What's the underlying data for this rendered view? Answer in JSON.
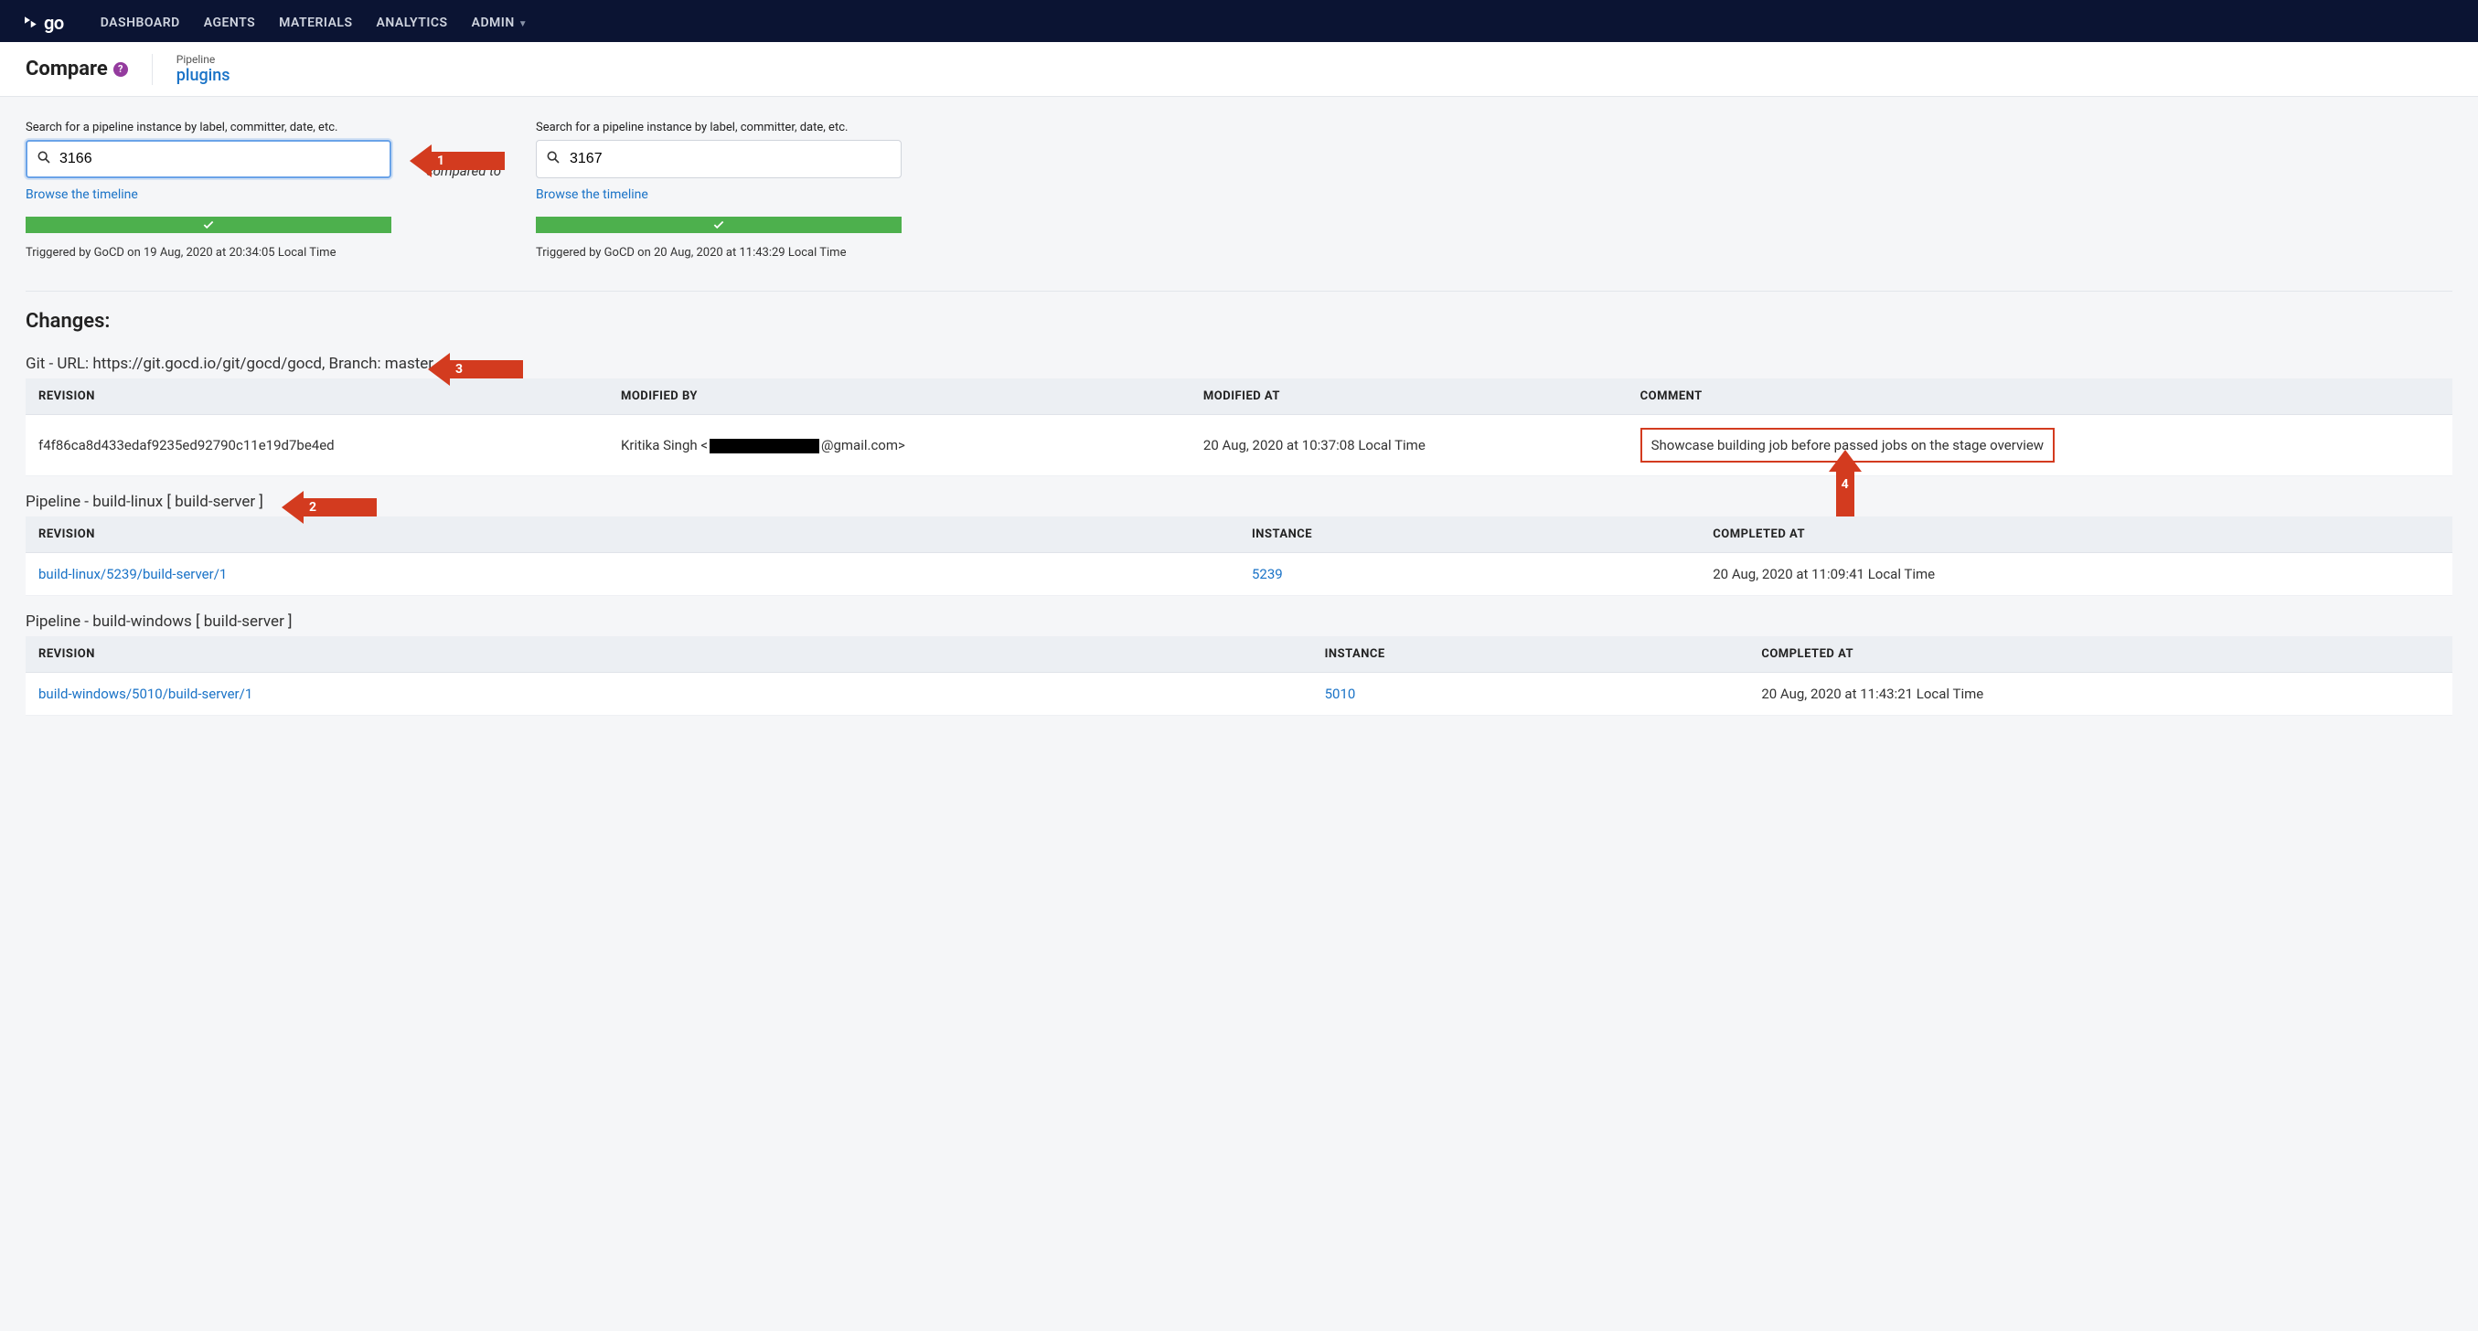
{
  "nav": {
    "brand": "go",
    "items": [
      "DASHBOARD",
      "AGENTS",
      "MATERIALS",
      "ANALYTICS",
      "ADMIN"
    ]
  },
  "subheader": {
    "title": "Compare",
    "pipeline_label": "Pipeline",
    "pipeline_name": "plugins"
  },
  "search_label": "Search for a pipeline instance by label, committer, date, etc.",
  "compared_to": "compared to",
  "timeline_link": "Browse the timeline",
  "instance_from": {
    "value": "3166",
    "triggered": "Triggered by GoCD on 19 Aug, 2020 at 20:34:05 Local Time"
  },
  "instance_to": {
    "value": "3167",
    "triggered": "Triggered by GoCD on 20 Aug, 2020 at 11:43:29 Local Time"
  },
  "annotations": {
    "a1": "1",
    "a2": "2",
    "a3": "3",
    "a4": "4"
  },
  "changes_header": "Changes:",
  "git_material": {
    "title": "Git - URL: https://git.gocd.io/git/gocd/gocd, Branch: master",
    "headers": {
      "revision": "REVISION",
      "modified_by": "MODIFIED BY",
      "modified_at": "MODIFIED AT",
      "comment": "COMMENT"
    },
    "rows": [
      {
        "revision": "f4f86ca8d433edaf9235ed92790c11e19d7be4ed",
        "modified_by_prefix": "Kritika Singh <",
        "modified_by_suffix": "@gmail.com>",
        "modified_at": "20 Aug, 2020 at 10:37:08 Local Time",
        "comment": "Showcase building job before passed jobs on the stage overview"
      }
    ]
  },
  "pipeline_materials": [
    {
      "title": "Pipeline - build-linux [ build-server ]",
      "headers": {
        "revision": "REVISION",
        "instance": "INSTANCE",
        "completed_at": "COMPLETED AT"
      },
      "rows": [
        {
          "revision": "build-linux/5239/build-server/1",
          "instance": "5239",
          "completed_at": "20 Aug, 2020 at 11:09:41 Local Time"
        }
      ]
    },
    {
      "title": "Pipeline - build-windows [ build-server ]",
      "headers": {
        "revision": "REVISION",
        "instance": "INSTANCE",
        "completed_at": "COMPLETED AT"
      },
      "rows": [
        {
          "revision": "build-windows/5010/build-server/1",
          "instance": "5010",
          "completed_at": "20 Aug, 2020 at 11:43:21 Local Time"
        }
      ]
    }
  ]
}
